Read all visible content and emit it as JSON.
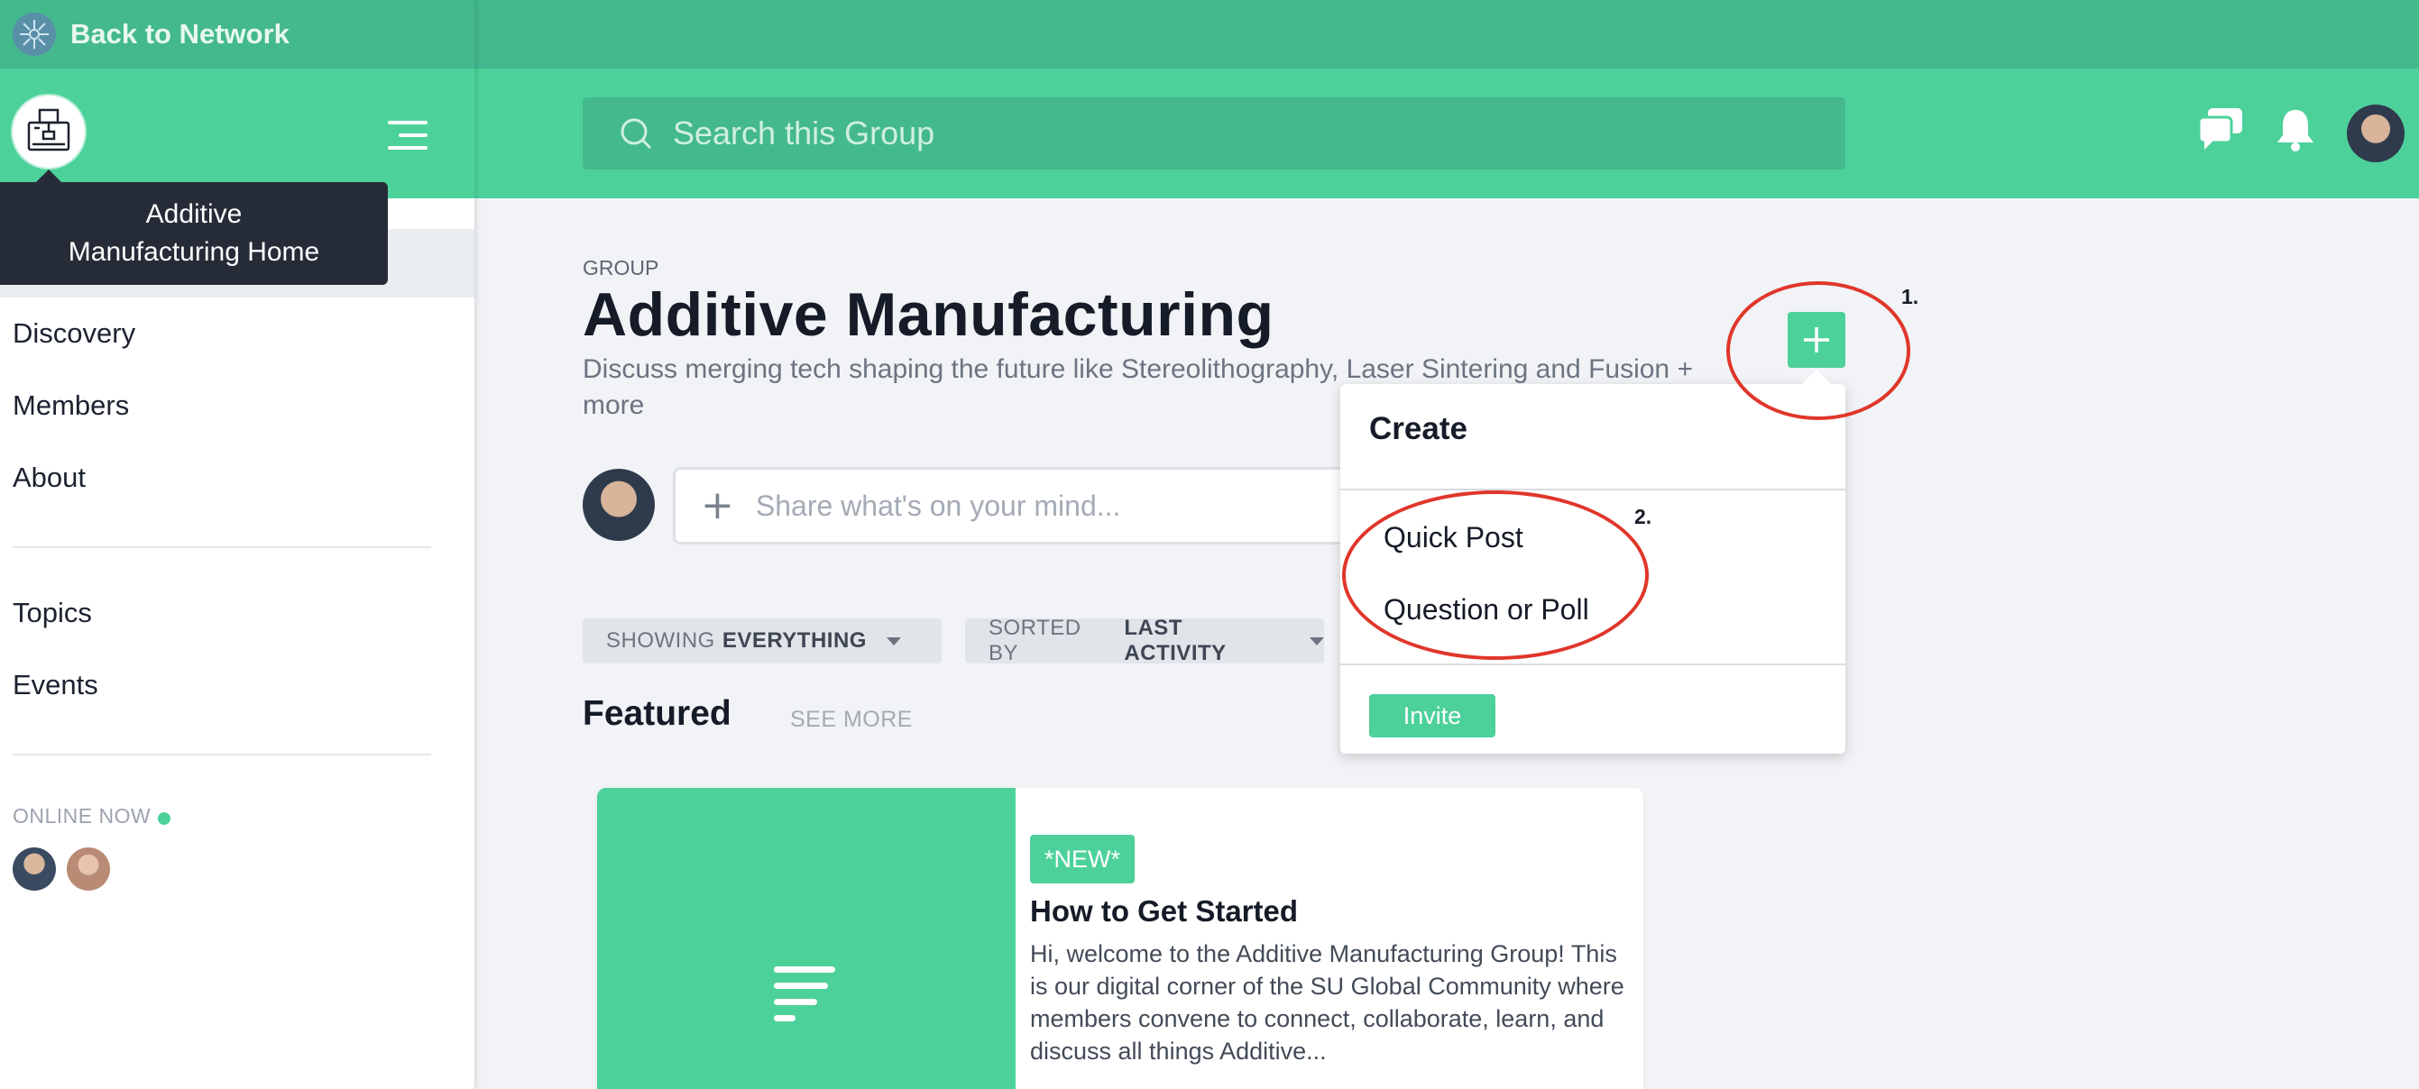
{
  "sidebar": {
    "back_label": "Back to Network",
    "tooltip": "Additive Manufacturing Home",
    "nav": [
      "Discovery",
      "Members",
      "About",
      "Topics",
      "Events"
    ],
    "online_label": "ONLINE NOW"
  },
  "header": {
    "search_placeholder": "Search this Group"
  },
  "group": {
    "label": "GROUP",
    "title": "Additive Manufacturing",
    "description": "Discuss merging tech shaping the future like Stereolithography, Laser Sintering and Fusion + more"
  },
  "composer": {
    "placeholder": "Share what's on your mind..."
  },
  "filters": {
    "showing_prefix": "SHOWING",
    "showing_value": "EVERYTHING",
    "sorted_prefix": "SORTED BY",
    "sorted_value": "LAST ACTIVITY"
  },
  "featured": {
    "heading": "Featured",
    "see_more": "SEE MORE",
    "card": {
      "badge": "*NEW*",
      "title": "How to Get Started",
      "excerpt": "Hi, welcome to the Additive Manufacturing Group! This is our digital corner of the SU Global Community where members convene to connect, collaborate, learn, and discuss all things Additive..."
    }
  },
  "create_menu": {
    "title": "Create",
    "items": [
      "Quick Post",
      "Question or Poll"
    ],
    "invite": "Invite"
  },
  "annotations": [
    "1.",
    "2."
  ],
  "colors": {
    "brand_green": "#4dd19b",
    "brand_green_dark": "#44b98e",
    "tooltip_bg": "#262c37",
    "annotation_red": "#e0362a"
  },
  "icons": [
    "network-logo-icon",
    "group-logo-icon",
    "menu-icon",
    "search-icon",
    "chat-icon",
    "bell-icon",
    "plus-icon",
    "document-icon"
  ]
}
